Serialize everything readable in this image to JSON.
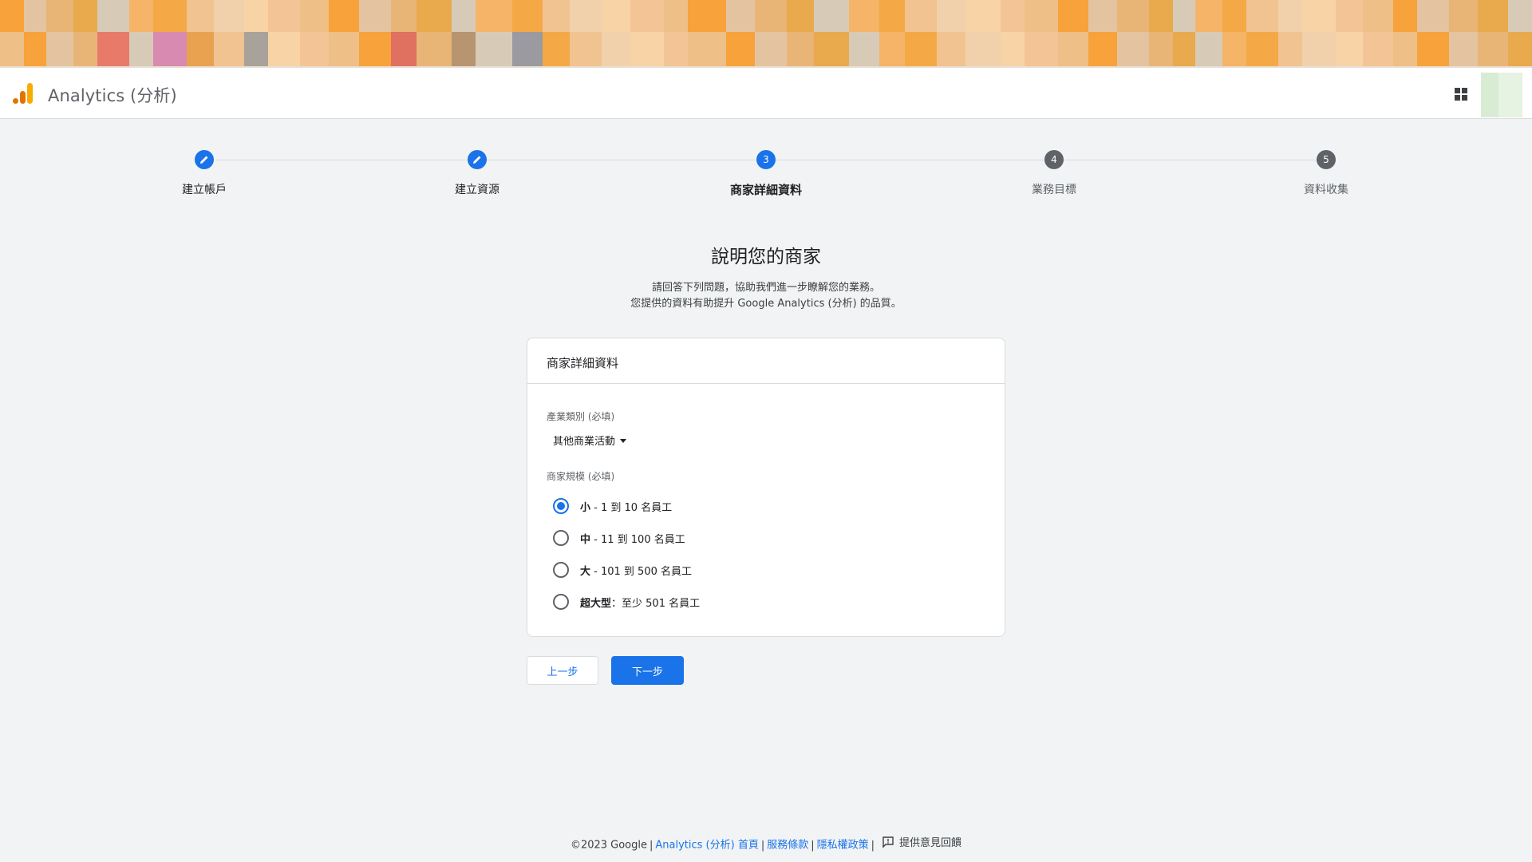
{
  "app": {
    "title": "Analytics (分析)"
  },
  "stepper": {
    "steps": [
      {
        "number": "1",
        "label": "建立帳戶",
        "state": "done"
      },
      {
        "number": "2",
        "label": "建立資源",
        "state": "done"
      },
      {
        "number": "3",
        "label": "商家詳細資料",
        "state": "active"
      },
      {
        "number": "4",
        "label": "業務目標",
        "state": "todo"
      },
      {
        "number": "5",
        "label": "資料收集",
        "state": "todo"
      }
    ]
  },
  "page": {
    "heading": "說明您的商家",
    "subtext_line1": "請回答下列問題，協助我們進一步瞭解您的業務。",
    "subtext_line2": "您提供的資料有助提升 Google Analytics (分析) 的品質。"
  },
  "card": {
    "title": "商家詳細資料",
    "industry_label": "產業類別 (必填)",
    "industry_value": "其他商業活動",
    "size_label": "商家規模 (必填)",
    "size_options": [
      {
        "bold": "小",
        "rest": " - 1 到 10 名員工",
        "checked": true
      },
      {
        "bold": "中",
        "rest": " - 11 到 100 名員工",
        "checked": false
      },
      {
        "bold": "大",
        "rest": " - 101 到 500 名員工",
        "checked": false
      },
      {
        "bold": "超大型",
        "rest": "：至少 501 名員工",
        "checked": false
      }
    ]
  },
  "buttons": {
    "back": "上一步",
    "next": "下一步"
  },
  "footer": {
    "copyright": "©2023 Google",
    "home_link": "Analytics (分析) 首頁",
    "terms_link": "服務條款",
    "privacy_link": "隱私權政策",
    "feedback": "提供意見回饋"
  },
  "colors": {
    "accent": "#1a73e8",
    "logo_orange": "#f9ab00",
    "logo_dark_orange": "#e37400"
  }
}
